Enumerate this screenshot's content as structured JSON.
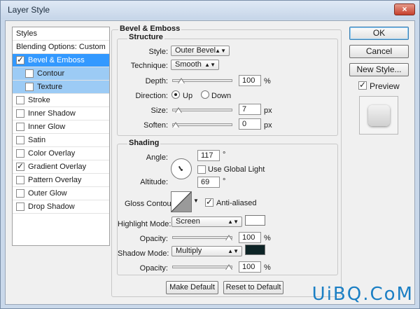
{
  "window": {
    "title": "Layer Style",
    "close_glyph": "×"
  },
  "left_list": {
    "items": [
      {
        "label": "Styles",
        "checkbox": false,
        "checked": false,
        "state": "header"
      },
      {
        "label": "Blending Options: Custom",
        "checkbox": false,
        "checked": false,
        "state": "header"
      },
      {
        "label": "Bevel & Emboss",
        "checkbox": true,
        "checked": true,
        "state": "selected"
      },
      {
        "label": "Contour",
        "checkbox": true,
        "checked": false,
        "state": "sub"
      },
      {
        "label": "Texture",
        "checkbox": true,
        "checked": false,
        "state": "sub"
      },
      {
        "label": "Stroke",
        "checkbox": true,
        "checked": false,
        "state": "normal"
      },
      {
        "label": "Inner Shadow",
        "checkbox": true,
        "checked": false,
        "state": "normal"
      },
      {
        "label": "Inner Glow",
        "checkbox": true,
        "checked": false,
        "state": "normal"
      },
      {
        "label": "Satin",
        "checkbox": true,
        "checked": false,
        "state": "normal"
      },
      {
        "label": "Color Overlay",
        "checkbox": true,
        "checked": false,
        "state": "normal"
      },
      {
        "label": "Gradient Overlay",
        "checkbox": true,
        "checked": true,
        "state": "normal"
      },
      {
        "label": "Pattern Overlay",
        "checkbox": true,
        "checked": false,
        "state": "normal"
      },
      {
        "label": "Outer Glow",
        "checkbox": true,
        "checked": false,
        "state": "normal"
      },
      {
        "label": "Drop Shadow",
        "checkbox": true,
        "checked": false,
        "state": "normal"
      }
    ]
  },
  "bevel": {
    "title": "Bevel & Emboss",
    "structure": {
      "title": "Structure",
      "style_label": "Style:",
      "style_value": "Outer Bevel",
      "technique_label": "Technique:",
      "technique_value": "Smooth",
      "depth_label": "Depth:",
      "depth_value": "100",
      "depth_unit": "%",
      "depth_level": 0.1,
      "direction_label": "Direction:",
      "direction_up": "Up",
      "direction_down": "Down",
      "direction_selected": "Up",
      "size_label": "Size:",
      "size_value": "7",
      "size_unit": "px",
      "size_level": 0.05,
      "soften_label": "Soften:",
      "soften_value": "0",
      "soften_unit": "px",
      "soften_level": 0.0
    },
    "shading": {
      "title": "Shading",
      "angle_label": "Angle:",
      "angle_value": "117",
      "angle_unit": "°",
      "global_light_label": "Use Global Light",
      "global_light_checked": false,
      "altitude_label": "Altitude:",
      "altitude_value": "69",
      "altitude_unit": "°",
      "gloss_label": "Gloss Contour:",
      "anti_aliased_label": "Anti-aliased",
      "anti_aliased_checked": true,
      "highlight_mode_label": "Highlight Mode:",
      "highlight_mode_value": "Screen",
      "highlight_color": "#ffffff",
      "highlight_opacity_label": "Opacity:",
      "highlight_opacity_value": "100",
      "highlight_opacity_unit": "%",
      "highlight_opacity_level": 1.0,
      "shadow_mode_label": "Shadow Mode:",
      "shadow_mode_value": "Multiply",
      "shadow_color": "#0d2426",
      "shadow_opacity_label": "Opacity:",
      "shadow_opacity_value": "100",
      "shadow_opacity_unit": "%",
      "shadow_opacity_level": 1.0
    },
    "make_default": "Make Default",
    "reset_default": "Reset to Default"
  },
  "right": {
    "ok": "OK",
    "cancel": "Cancel",
    "new_style": "New Style...",
    "preview_label": "Preview",
    "preview_checked": true
  },
  "watermark": "UiBQ.CoM"
}
